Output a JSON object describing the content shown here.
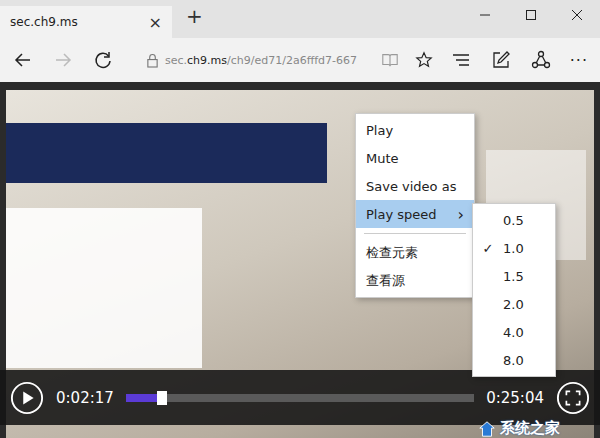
{
  "window": {
    "tab_title": "sec.ch9.ms",
    "tab_close": "×",
    "new_tab": "+"
  },
  "address_bar": {
    "url_prefix": "sec.",
    "url_domain": "ch9.ms",
    "url_path": "/ch9/ed71/2a6fffd7-667",
    "back_enabled": true,
    "forward_enabled": false,
    "more": "···"
  },
  "player": {
    "current_time": "0:02:17",
    "duration": "0:25:04",
    "level": 0.09
  },
  "context_menu": {
    "submenu_arrow": "›",
    "items": [
      {
        "kind": "item",
        "label": "Play",
        "has_submenu": false,
        "selected": false
      },
      {
        "kind": "item",
        "label": "Mute",
        "has_submenu": false,
        "selected": false
      },
      {
        "kind": "item",
        "label": "Save video as",
        "has_submenu": false,
        "selected": false
      },
      {
        "kind": "item",
        "label": "Play speed",
        "has_submenu": true,
        "selected": true
      },
      {
        "kind": "separator",
        "label": "",
        "has_submenu": false,
        "selected": false
      },
      {
        "kind": "item",
        "label": "检查元素",
        "has_submenu": false,
        "selected": false
      },
      {
        "kind": "item",
        "label": "查看源",
        "has_submenu": false,
        "selected": false
      }
    ]
  },
  "speed_menu": {
    "check": "✓",
    "items": [
      {
        "label": "0.5",
        "checked": false
      },
      {
        "label": "1.0",
        "checked": true
      },
      {
        "label": "1.5",
        "checked": false
      },
      {
        "label": "2.0",
        "checked": false
      },
      {
        "label": "4.0",
        "checked": false
      },
      {
        "label": "8.0",
        "checked": false
      }
    ]
  },
  "watermark": {
    "text": "系统之家"
  }
}
